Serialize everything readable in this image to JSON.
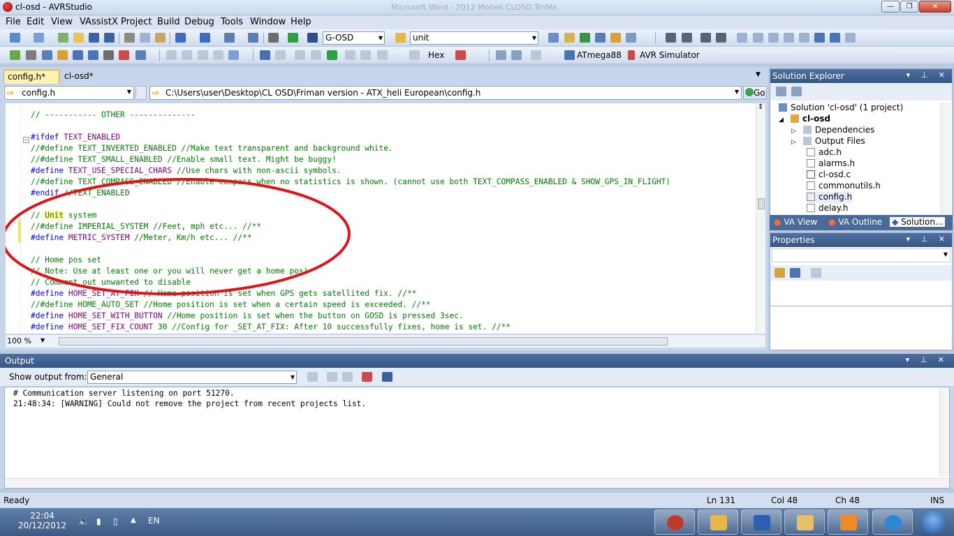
{
  "window": {
    "title": "cl-osd - AVRStudio",
    "ghost_title": "Microsoft Word - 2012 Moheli CLOSD TrnMe"
  },
  "menu": [
    "File",
    "Edit",
    "View",
    "VAssistX",
    "Project",
    "Build",
    "Debug",
    "Tools",
    "Window",
    "Help"
  ],
  "toolbar1": {
    "config_combo": "G-OSD",
    "find_combo": "unit"
  },
  "toolbar2": {
    "hex_label": "Hex",
    "device_label": "ATmega88",
    "simulator_label": "AVR Simulator"
  },
  "tabs": [
    {
      "label": "config.h*"
    },
    {
      "label": "cl-osd*"
    }
  ],
  "nav": {
    "file": "config.h",
    "path": "C:\\Users\\user\\Desktop\\CL OSD\\Friman version - ATX_heli European\\config.h",
    "go_label": "Go"
  },
  "code_lines": [
    {
      "pre": "",
      "kw": "",
      "mac": "",
      "rest": "// ----------- OTHER --------------"
    },
    {
      "pre": "",
      "kw": "#ifdef",
      "mac": " TEXT_ENABLED",
      "rest": ""
    },
    {
      "pre": "//#define TEXT_INVERTED_ENABLED //Make text transparent and background white.",
      "kw": "",
      "mac": "",
      "rest": ""
    },
    {
      "pre": "//#define TEXT_SMALL_ENABLED //Enable small text. Might be buggy!",
      "kw": "",
      "mac": "",
      "rest": ""
    },
    {
      "pre": "",
      "kw": "#define",
      "mac": " TEXT_USE_SPECIAL_CHARS",
      "rest": " //Use chars with non-ascii symbols."
    },
    {
      "pre": "//#define TEXT_COMPASS_ENABLED //Enable compass when no statistics is shown. (cannot use both TEXT_COMPASS_ENABLED & SHOW_GPS_IN_FLIGHT)",
      "kw": "",
      "mac": "",
      "rest": ""
    },
    {
      "pre": "",
      "kw": "#endif",
      "mac": "",
      "rest": " //TEXT_ENABLED"
    },
    {
      "pre": "",
      "kw": "",
      "mac": "",
      "rest": ""
    },
    {
      "pre": "// ",
      "hl": "Unit",
      "kw": "",
      "mac": "",
      "rest": " system"
    },
    {
      "pre": "//#define IMPERIAL_SYSTEM //Feet, mph etc... //**",
      "kw": "",
      "mac": "",
      "rest": ""
    },
    {
      "pre": "",
      "kw": "#define",
      "mac": " METRIC_SYSTEM",
      "rest": " //Meter, Km/h etc... //**"
    },
    {
      "pre": "",
      "kw": "",
      "mac": "",
      "rest": ""
    },
    {
      "pre": "// Home pos set",
      "kw": "",
      "mac": "",
      "rest": ""
    },
    {
      "pre": "// Note: Use at least one or you will never get a home pos!",
      "kw": "",
      "mac": "",
      "rest": ""
    },
    {
      "pre": "// Comment out unwanted to disable",
      "kw": "",
      "mac": "",
      "rest": ""
    },
    {
      "pre": "",
      "kw": "#define",
      "mac": " HOME_SET_AT_FIX",
      "rest": " // Home position is set when GPS gets satellited fix. //**"
    },
    {
      "pre": "//#define HOME_AUTO_SET //Home position is set when a certain speed is exceeded. //**",
      "kw": "",
      "mac": "",
      "rest": ""
    },
    {
      "pre": "",
      "kw": "#define",
      "mac": " HOME_SET_WITH_BUTTON",
      "rest": " //Home position is set when the button on GOSD is pressed 3sec."
    },
    {
      "pre": "",
      "kw": "#define",
      "mac": " HOME_SET_FIX_COUNT",
      "num": " 30",
      "rest": " //Config for _SET_AT_FIX: After 10 successfully fixes, home is set. //**"
    }
  ],
  "zoom": "100 %",
  "solution_explorer": {
    "title": "Solution Explorer",
    "root": "Solution 'cl-osd' (1 project)",
    "project": "cl-osd",
    "folders": [
      "Dependencies",
      "Output Files"
    ],
    "files": [
      "adc.h",
      "alarms.h",
      "cl-osd.c",
      "commonutils.h",
      "config.h",
      "delay.h"
    ],
    "tabs": [
      "VA View",
      "VA Outline",
      "Solution..."
    ]
  },
  "properties": {
    "title": "Properties"
  },
  "output": {
    "title": "Output",
    "show_from_label": "Show output from:",
    "source": "General",
    "lines": [
      "# Communication server listening on port 51270.",
      "21:48:34: [WARNING] Could not remove the project from recent projects list."
    ]
  },
  "status": {
    "ready": "Ready",
    "ln": "Ln 131",
    "col": "Col 48",
    "ch": "Ch 48",
    "mode": "INS"
  },
  "taskbar": {
    "time": "22:04",
    "date": "20/12/2012",
    "lang": "EN"
  },
  "colors": {
    "annotation": "#e0151b",
    "keyword": "#0000ff",
    "macro": "#8b008b",
    "comment": "#008000"
  }
}
